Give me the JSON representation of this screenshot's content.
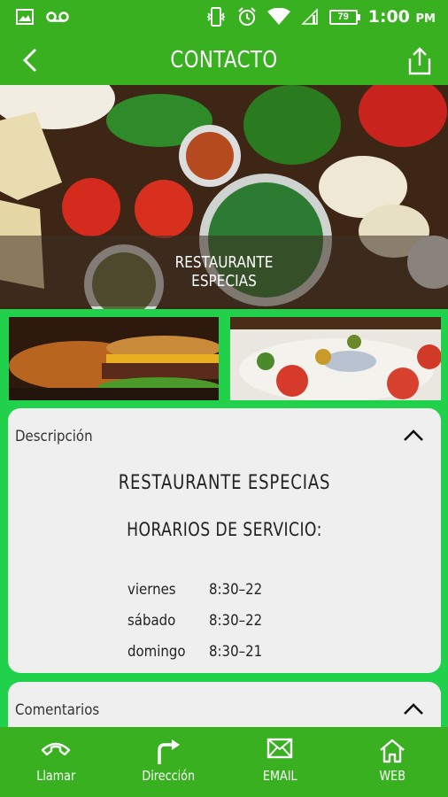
{
  "status_bar": {
    "time": "1:00",
    "ampm": "PM",
    "battery": "79"
  },
  "app_bar": {
    "title": "CONTACTO"
  },
  "hero": {
    "caption_line1": "RESTAURANTE",
    "caption_line2": "ESPECIAS"
  },
  "description_card": {
    "header": "Descripción",
    "title": "RESTAURANTE  ESPECIAS",
    "subtitle": "HORARIOS DE SERVICIO:",
    "schedule": [
      {
        "day": "viernes",
        "hours": "8:30–22"
      },
      {
        "day": "sábado",
        "hours": "8:30–22"
      },
      {
        "day": "domingo",
        "hours": "8:30–21"
      }
    ]
  },
  "comments_card": {
    "header": "Comentarios"
  },
  "bottom_nav": [
    {
      "label": "Llamar",
      "icon": "phone-icon"
    },
    {
      "label": "Dirección",
      "icon": "turn-right-arrow-icon"
    },
    {
      "label": "EMAIL",
      "icon": "envelope-icon"
    },
    {
      "label": "WEB",
      "icon": "home-icon"
    }
  ],
  "colors": {
    "primary": "#38b020",
    "background": "#21d04b",
    "card": "#efefef"
  }
}
